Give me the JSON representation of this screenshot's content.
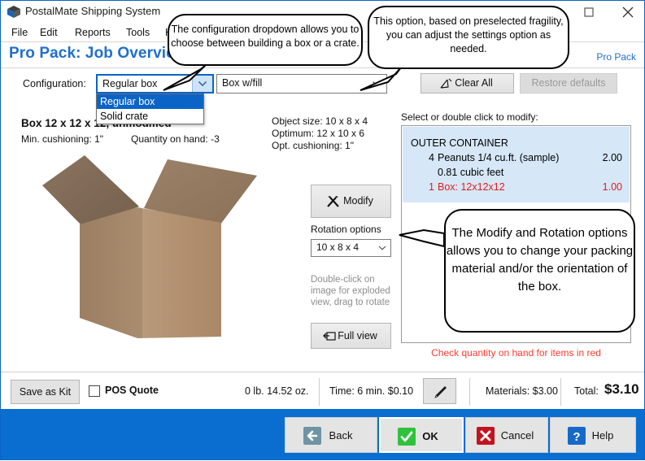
{
  "window": {
    "title": "PostalMate Shipping System",
    "logo_icon": "box-logo-icon",
    "maximize_icon": "maximize-icon",
    "close_icon": "close-icon"
  },
  "menu": {
    "items": [
      {
        "label": "File"
      },
      {
        "label": "Edit"
      },
      {
        "label": "Reports"
      },
      {
        "label": "Tools"
      },
      {
        "label": "Help"
      }
    ]
  },
  "header": {
    "page_title": "Pro Pack: Job Overview",
    "right_link": "Pro Pack",
    "title_color": "#1f6fd0"
  },
  "config_row": {
    "label": "Configuration:",
    "configuration_value": "Regular box",
    "fill_value": "Box w/fill",
    "dropdown_open": true,
    "dropdown_options": [
      {
        "label": "Regular box",
        "selected": true
      },
      {
        "label": "Solid crate",
        "selected": false
      }
    ],
    "clear_all": "Clear All",
    "clear_all_icon": "broom-icon",
    "restore_defaults": "Restore defaults",
    "restore_defaults_disabled": true
  },
  "box_info": {
    "title": "Box 12 x 12 x 12, unmodified",
    "min_cushioning_label": "Min. cushioning:",
    "min_cushioning_value": "1\"",
    "quantity_label": "Quantity on hand:",
    "quantity_value": "-3",
    "object_size": "Object size: 10 x 8 x 4",
    "optimum": "Optimum: 12 x 10 x 6",
    "opt_cushioning": "Opt. cushioning: 1\"",
    "image_icon": "cardboard-box-illustration"
  },
  "center_controls": {
    "modify_label": "Modify",
    "modify_icon": "tools-icon",
    "rotation_label": "Rotation options",
    "rotation_value": "10 x 8 x 4",
    "hint": "Double-click on image for exploded view, drag to rotate",
    "full_view_label": "Full view",
    "full_view_icon": "expand-arrow-icon"
  },
  "items_panel": {
    "select_label": "Select or double click to modify:",
    "header_row": "OUTER CONTAINER",
    "rows": [
      {
        "qty": "4",
        "name": "Peanuts 1/4 cu.ft. (sample)",
        "price": "2.00",
        "red": false
      },
      {
        "qty": "",
        "name": "0.81 cubic feet",
        "price": "",
        "red": false
      },
      {
        "qty": "1",
        "name": "Box: 12x12x12",
        "price": "1.00",
        "red": true
      }
    ],
    "warning": "Check quantity on hand for items in red",
    "warning_color": "#ff3b30",
    "selection_color": "#d6e7f7"
  },
  "footer": {
    "save_as_kit": "Save as Kit",
    "pos_quote": "POS Quote",
    "pos_quote_checked": false,
    "weight": "0 lb. 14.52 oz.",
    "time": "Time: 6 min. $0.10",
    "edit_icon": "pencil-icon",
    "materials": "Materials:  $3.00",
    "total_label": "Total:",
    "total_value": "$3.10"
  },
  "action_bar": {
    "background": "#0a6ed1",
    "buttons": [
      {
        "label": "Back",
        "icon": "back-arrow-icon",
        "focused": false
      },
      {
        "label": "OK",
        "icon": "check-icon",
        "focused": true
      },
      {
        "label": "Cancel",
        "icon": "x-icon",
        "focused": false
      },
      {
        "label": "Help",
        "icon": "question-icon",
        "focused": false
      }
    ]
  },
  "callouts": [
    {
      "id": "configuration",
      "text": "The configuration dropdown allows you to choose between building a box or a crate."
    },
    {
      "id": "option",
      "text": "This option, based on preselected fragility, you can adjust the settings option as needed."
    },
    {
      "id": "modify",
      "text": "The Modify and Rotation options allows you to change your packing material and/or the orientation of the box."
    }
  ]
}
